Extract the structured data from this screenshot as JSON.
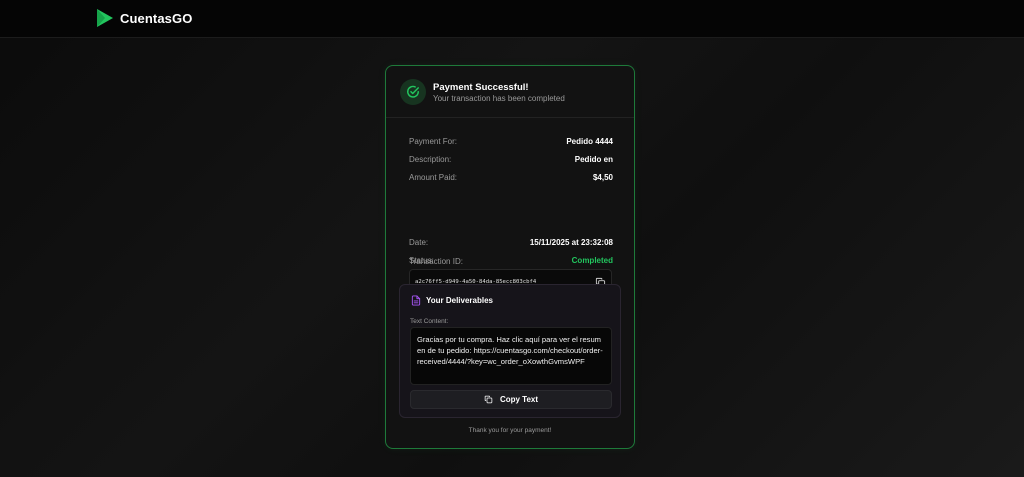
{
  "brand": {
    "name": "CuentasGO",
    "logo_icon": "play-triangle-icon",
    "accent": "#22c55e"
  },
  "card": {
    "header": {
      "icon": "check-circle-icon",
      "title": "Payment Successful!",
      "subtitle": "Your transaction has been completed"
    },
    "details": {
      "payment_for": {
        "label": "Payment For:",
        "value": "Pedido 4444"
      },
      "description": {
        "label": "Description:",
        "value": "Pedido en"
      },
      "amount_paid": {
        "label": "Amount Paid:",
        "value": "$4,50"
      },
      "transaction": {
        "label": "Transaction ID:",
        "value": "a2c76ff5-d949-4a50-84da-85ecc803cbf4",
        "copy_icon": "copy-icon"
      },
      "date": {
        "label": "Date:",
        "value": "15/11/2025 at 23:32:08"
      },
      "status": {
        "label": "Status:",
        "value": "Completed",
        "color": "#22c55e"
      }
    },
    "deliverables": {
      "icon": "document-icon",
      "title": "Your Deliverables",
      "text_label": "Text Content:",
      "text_content": "Gracias por tu compra. Haz clic aquí para ver el resumen de tu pedido: https://cuentasgo.com/checkout/order-received/4444/?key=wc_order_oXowthGvmsWPF",
      "copy_button": {
        "icon": "copy-icon",
        "label": "Copy Text"
      }
    },
    "footer": "Thank you for your payment!"
  },
  "colors": {
    "success": "#22c55e",
    "card_border": "#1e7a3a",
    "deliverables_accent": "#a855f7"
  }
}
